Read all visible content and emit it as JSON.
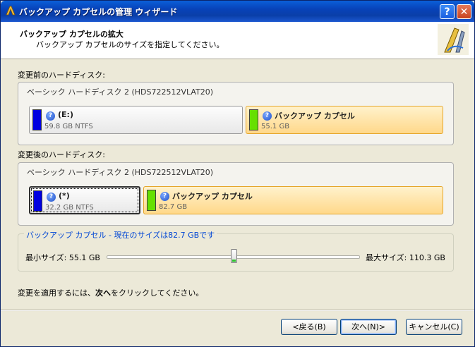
{
  "window": {
    "title": "バックアップ カプセルの管理 ウィザード",
    "help_label": "?",
    "close_label": "✕"
  },
  "header": {
    "title": "バックアップ カプセルの拡大",
    "subtitle": "バックアップ カプセルのサイズを指定してください。"
  },
  "before": {
    "label": "変更前のハードディスク:",
    "disk_title": "ベーシック ハードディスク 2 (HDS722512VLAT20)",
    "partitions": [
      {
        "name": "(E:)",
        "size": "59.8 GB  NTFS",
        "color": "#0000e0"
      },
      {
        "name": "バックアップ カプセル",
        "size": "55.1 GB",
        "color": "#66e000"
      }
    ]
  },
  "after": {
    "label": "変更後のハードディスク:",
    "disk_title": "ベーシック ハードディスク 2 (HDS722512VLAT20)",
    "partitions": [
      {
        "name": "(*)",
        "size": "32.2 GB  NTFS",
        "color": "#0000e0"
      },
      {
        "name": "バックアップ カプセル",
        "size": "82.7 GB",
        "color": "#66e000"
      }
    ]
  },
  "slider": {
    "group_title": "バックアップ カプセル - 現在のサイズは82.7 GBです",
    "min_label": "最小サイズ:  55.1 GB",
    "max_label": "最大サイズ:  110.3 GB",
    "value_gb": 82.7,
    "min_gb": 55.1,
    "max_gb": 110.3
  },
  "instruction": {
    "prefix": "変更を適用するには、",
    "bold": "次へ",
    "suffix": "をクリックしてください。"
  },
  "buttons": {
    "back": "<戻る(B)",
    "next": "次へ(N)>",
    "cancel": "キャンセル(C)"
  },
  "colors": {
    "titlebar": "#0842b8",
    "backup_fill": "#ffd88a",
    "link_blue": "#0046d5"
  }
}
